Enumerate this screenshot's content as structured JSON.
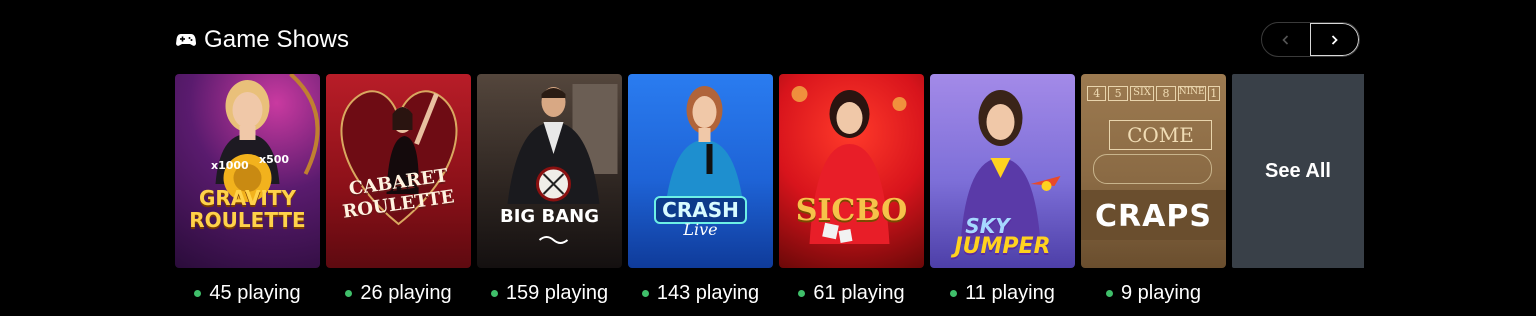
{
  "section": {
    "icon": "gamepad-icon",
    "title": "Game Shows"
  },
  "nav": {
    "prev_icon": "chevron-left-icon",
    "next_icon": "chevron-right-icon"
  },
  "games": [
    {
      "logo_line1": "GRAVITY",
      "logo_line2": "ROULETTE",
      "badges": [
        "x1000",
        "x500"
      ],
      "players": "45 playing",
      "colors": {
        "bg": "#5a1b6e",
        "accent": "#f5b820"
      }
    },
    {
      "logo_line1": "CABARET",
      "logo_line2": "ROULETTE",
      "players": "26 playing",
      "colors": {
        "bg": "#9e1b22",
        "accent": "#f0d9b0"
      }
    },
    {
      "logo_line1": "BIG BANG",
      "players": "159 playing",
      "colors": {
        "bg": "#3a2a22",
        "accent": "#ffffff"
      }
    },
    {
      "logo_line1": "CRASH",
      "logo_line2": "Live",
      "players": "143 playing",
      "colors": {
        "bg": "#1e63d6",
        "accent": "#6df0e6"
      }
    },
    {
      "logo_line1": "SICBO",
      "players": "61 playing",
      "colors": {
        "bg": "#d8141c",
        "accent": "#f6c24a"
      }
    },
    {
      "logo_line1": "SKY",
      "logo_line2": "JUMPER",
      "players": "11 playing",
      "colors": {
        "bg": "#7d6fd8",
        "accent": "#ffd21f"
      }
    },
    {
      "logo_line1": "CRAPS",
      "table_numbers": [
        "4",
        "5",
        "SIX",
        "8",
        "NINE",
        "1"
      ],
      "table_word": "COME",
      "players": "9 playing",
      "colors": {
        "bg": "#8a6a44",
        "accent": "#f0dcb4"
      }
    }
  ],
  "see_all": "See All"
}
